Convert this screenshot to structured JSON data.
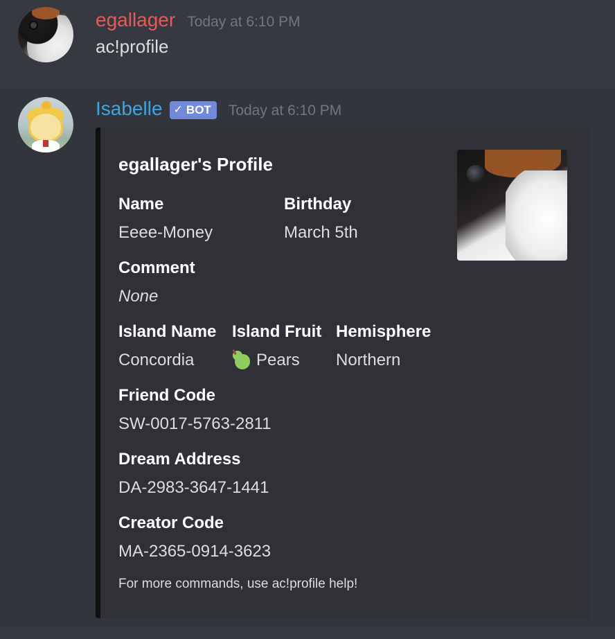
{
  "messages": [
    {
      "username": "egallager",
      "timestamp": "Today at 6:10 PM",
      "content": "ac!profile",
      "username_color": "#e55b5b"
    },
    {
      "username": "Isabelle",
      "bot_tag": "BOT",
      "timestamp": "Today at 6:10 PM",
      "username_color": "#3fa5e0"
    }
  ],
  "embed": {
    "title": "egallager's Profile",
    "fields": {
      "name": {
        "label": "Name",
        "value": "Eeee-Money"
      },
      "birthday": {
        "label": "Birthday",
        "value": "March 5th"
      },
      "comment": {
        "label": "Comment",
        "value": "None"
      },
      "island_name": {
        "label": "Island Name",
        "value": "Concordia"
      },
      "island_fruit": {
        "label": "Island Fruit",
        "value": "Pears",
        "icon": "pear-icon"
      },
      "hemisphere": {
        "label": "Hemisphere",
        "value": "Northern"
      },
      "friend_code": {
        "label": "Friend Code",
        "value": "SW-0017-5763-2811"
      },
      "dream_address": {
        "label": "Dream Address",
        "value": "DA-2983-3647-1441"
      },
      "creator_code": {
        "label": "Creator Code",
        "value": "MA-2365-0914-3623"
      }
    },
    "footer": "For more commands, use ac!profile help!"
  },
  "colors": {
    "background": "#36393f",
    "embed_background": "#2f3136",
    "bot_tag": "#7289da"
  }
}
